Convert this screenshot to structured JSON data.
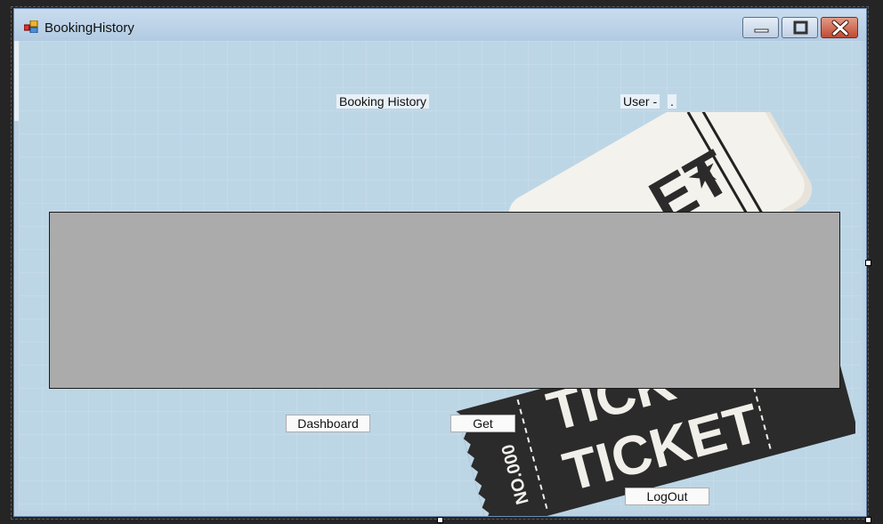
{
  "window": {
    "title": "BookingHistory",
    "controls": {
      "minimize_icon": "minimize-icon",
      "maximize_icon": "maximize-icon",
      "close_icon": "close-icon"
    }
  },
  "form": {
    "heading": "Booking History",
    "user_label": "User -",
    "username_value": "."
  },
  "buttons": {
    "dashboard": "Dashboard",
    "get": "Get",
    "logout": "LogOut"
  },
  "background_art": {
    "ticket_text": "TICKET",
    "ticket_partial_text": "TICK",
    "serial_text": "NO.000",
    "top_partial_text": "ET"
  },
  "colors": {
    "client_background": "#bdd6e6",
    "grid_background": "#ababab",
    "close_button": "#c14a32",
    "ticket_dark": "#2b2b2b",
    "ticket_light": "#f1efe9"
  }
}
